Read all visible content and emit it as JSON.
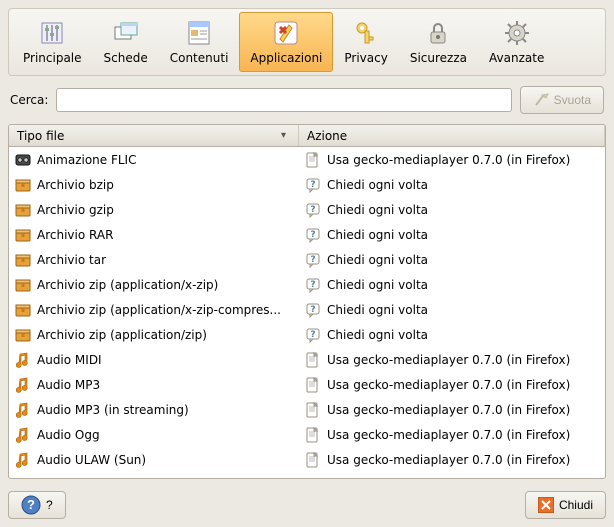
{
  "toolbar": {
    "principale": "Principale",
    "schede": "Schede",
    "contenuti": "Contenuti",
    "applicazioni": "Applicazioni",
    "privacy": "Privacy",
    "sicurezza": "Sicurezza",
    "avanzate": "Avanzate"
  },
  "search": {
    "label": "Cerca:",
    "value": "",
    "placeholder": "",
    "svuota": "Svuota"
  },
  "columns": {
    "tipo": "Tipo file",
    "azione": "Azione"
  },
  "rows": [
    {
      "kind": "video",
      "tipo": "Animazione FLIC",
      "actKind": "app",
      "azione": "Usa gecko-mediaplayer 0.7.0 (in Firefox)"
    },
    {
      "kind": "archive",
      "tipo": "Archivio bzip",
      "actKind": "ask",
      "azione": "Chiedi ogni volta"
    },
    {
      "kind": "archive",
      "tipo": "Archivio gzip",
      "actKind": "ask",
      "azione": "Chiedi ogni volta"
    },
    {
      "kind": "archive",
      "tipo": "Archivio RAR",
      "actKind": "ask",
      "azione": "Chiedi ogni volta"
    },
    {
      "kind": "archive",
      "tipo": "Archivio tar",
      "actKind": "ask",
      "azione": "Chiedi ogni volta"
    },
    {
      "kind": "archive",
      "tipo": "Archivio zip (application/x-zip)",
      "actKind": "ask",
      "azione": "Chiedi ogni volta"
    },
    {
      "kind": "archive",
      "tipo": "Archivio zip (application/x-zip-compres...",
      "actKind": "ask",
      "azione": "Chiedi ogni volta"
    },
    {
      "kind": "archive",
      "tipo": "Archivio zip (application/zip)",
      "actKind": "ask",
      "azione": "Chiedi ogni volta"
    },
    {
      "kind": "audio",
      "tipo": "Audio MIDI",
      "actKind": "app",
      "azione": "Usa gecko-mediaplayer 0.7.0 (in Firefox)"
    },
    {
      "kind": "audio",
      "tipo": "Audio MP3",
      "actKind": "app",
      "azione": "Usa gecko-mediaplayer 0.7.0 (in Firefox)"
    },
    {
      "kind": "audio",
      "tipo": "Audio MP3 (in streaming)",
      "actKind": "app",
      "azione": "Usa gecko-mediaplayer 0.7.0 (in Firefox)"
    },
    {
      "kind": "audio",
      "tipo": "Audio Ogg",
      "actKind": "app",
      "azione": "Usa gecko-mediaplayer 0.7.0 (in Firefox)"
    },
    {
      "kind": "audio",
      "tipo": "Audio ULAW (Sun)",
      "actKind": "app",
      "azione": "Usa gecko-mediaplayer 0.7.0 (in Firefox)"
    }
  ],
  "footer": {
    "help": "?",
    "chiudi": "Chiudi"
  }
}
